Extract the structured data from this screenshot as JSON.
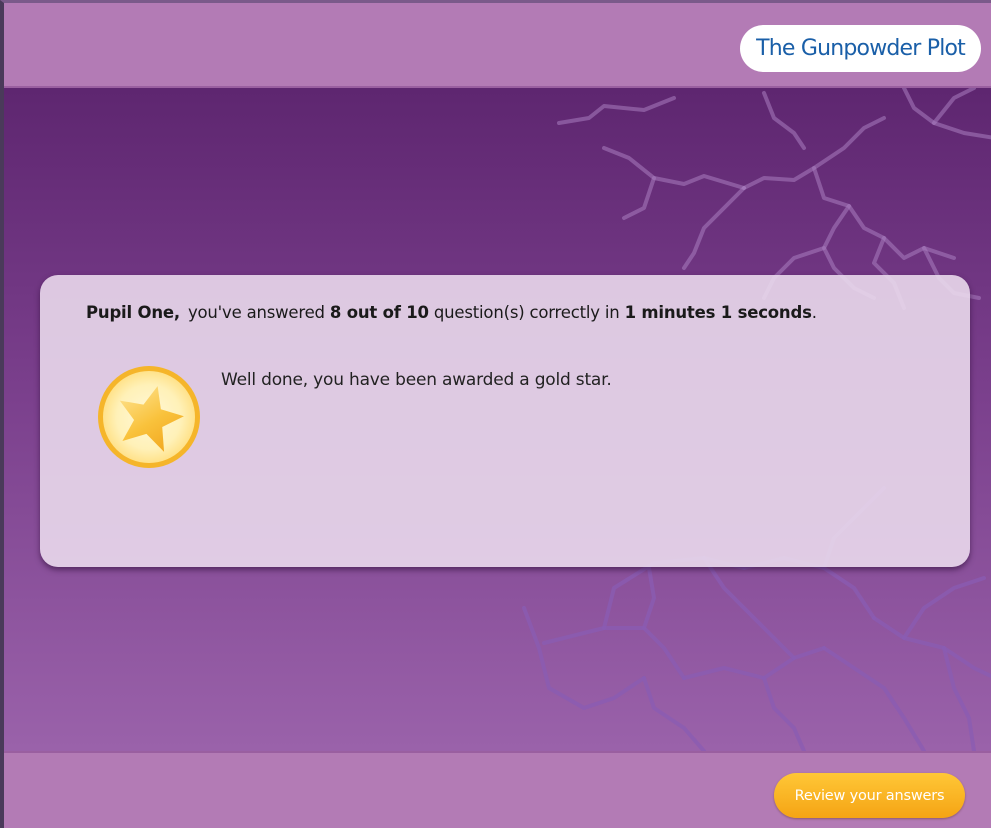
{
  "header": {
    "title": "The Gunpowder Plot"
  },
  "result": {
    "pupil_name": "Pupil One,",
    "answered_prefix": "you've answered",
    "score": "8 out of 10",
    "middle_text": "question(s) correctly in",
    "time": "1 minutes 1 seconds",
    "end_punct": ".",
    "award_message": "Well done, you have been awarded a gold star.",
    "award_icon": "gold-star-icon"
  },
  "footer": {
    "review_button_label": "Review your answers"
  },
  "colors": {
    "header_bar": "#b37bb5",
    "background_top": "#5e2670",
    "background_bottom": "#9a62aa",
    "title_text": "#1a5fa8",
    "button": "#f5a414",
    "card": "#ecddee"
  }
}
